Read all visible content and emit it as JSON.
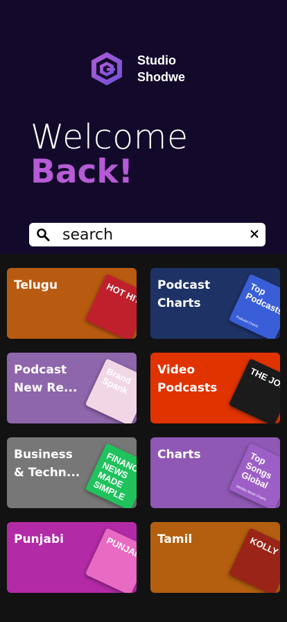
{
  "brand": {
    "name_line1": "Studio",
    "name_line2": "Shodwe",
    "logo_icon": "hexagon-spiral-logo-icon"
  },
  "greeting": {
    "line1": "Welcome",
    "line2": "Back!"
  },
  "search": {
    "placeholder": "search",
    "search_icon": "search-icon",
    "clear_icon": "close-icon"
  },
  "colors": {
    "background": "#13092a",
    "accent": "#b65bd6",
    "grid_background": "#121212"
  },
  "categories": [
    {
      "label": "Telugu",
      "color": "#b85b10",
      "art_text": "HOT HITS",
      "art_color": "#c0202c"
    },
    {
      "label": "Podcast\nCharts",
      "color": "#1e3266",
      "art_text": "Top Podcasts",
      "art_small": "Podcast Charts",
      "art_color": "#3a5ed8"
    },
    {
      "label": "Podcast\nNew Re...",
      "color": "#8e66ac",
      "art_text": "Brand Spank",
      "art_color": "#f1d7e6"
    },
    {
      "label": "Video\nPodcasts",
      "color": "#e13300",
      "art_text": "THE JOE",
      "art_color": "#1b1b1b"
    },
    {
      "label": "Business\n& Techn...",
      "color": "#777777",
      "art_text": "FINANCIAL NEWS MADE SIMPLE",
      "art_color": "#1fc25c"
    },
    {
      "label": "Charts",
      "color": "#8e58b4",
      "art_text": "Top Songs Global",
      "art_small": "Weekly Music Charts",
      "art_color": "#9d5fc6"
    },
    {
      "label": "Punjabi",
      "color": "#b22aa6",
      "art_text": "PUNJABI",
      "art_color": "#e86ac2"
    },
    {
      "label": "Tamil",
      "color": "#b35f0f",
      "art_text": "KOLLY",
      "art_color": "#9a2418"
    }
  ]
}
